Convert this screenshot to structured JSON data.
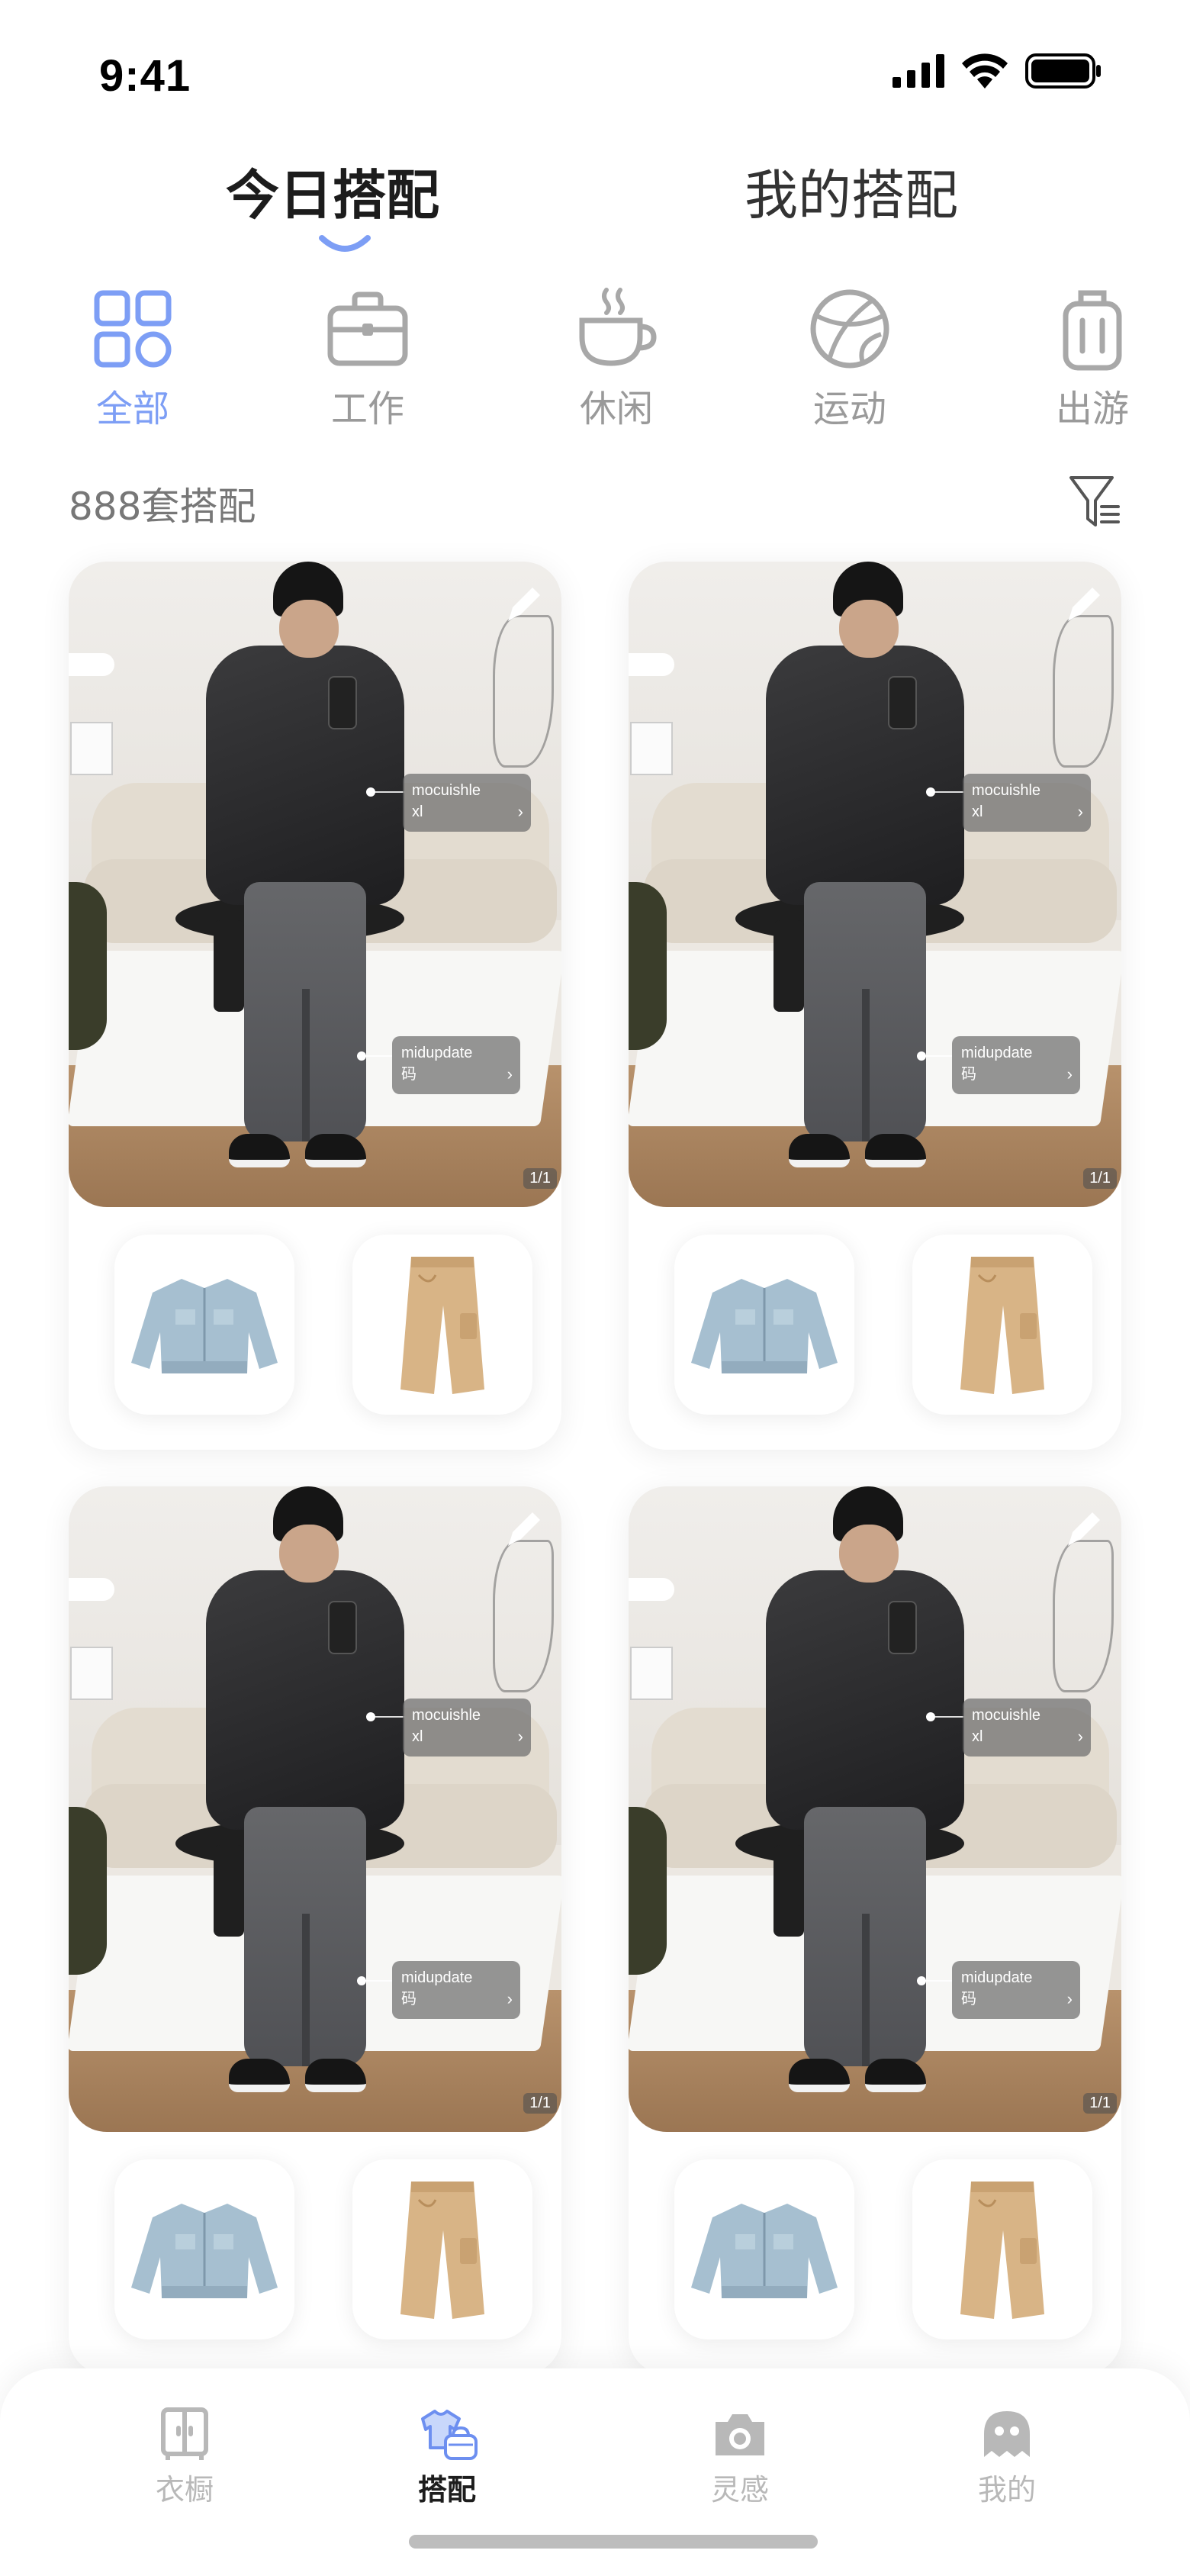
{
  "status_bar": {
    "time": "9:41",
    "icons": [
      "signal-icon",
      "wifi-icon",
      "battery-icon"
    ]
  },
  "top_tabs": [
    {
      "label": "今日搭配",
      "active": true
    },
    {
      "label": "我的搭配",
      "active": false
    }
  ],
  "categories": [
    {
      "label": "全部",
      "icon": "grid-icon",
      "active": true
    },
    {
      "label": "工作",
      "icon": "briefcase-icon",
      "active": false
    },
    {
      "label": "休闲",
      "icon": "coffee-cup-icon",
      "active": false
    },
    {
      "label": "运动",
      "icon": "basketball-icon",
      "active": false
    },
    {
      "label": "出游",
      "icon": "luggage-icon",
      "active": false
    }
  ],
  "outfit_count": "888套搭配",
  "filter_icon": "filter-icon",
  "outfits": [
    {
      "tags": [
        {
          "brand": "mocuishle",
          "size": "xl"
        },
        {
          "brand": "midupdate",
          "size": "码"
        }
      ],
      "page": "1/1",
      "items": [
        "denim-jacket",
        "khaki-pants"
      ]
    },
    {
      "tags": [
        {
          "brand": "mocuishle",
          "size": "xl"
        },
        {
          "brand": "midupdate",
          "size": "码"
        }
      ],
      "page": "1/1",
      "items": [
        "denim-jacket",
        "khaki-pants"
      ]
    },
    {
      "tags": [
        {
          "brand": "mocuishle",
          "size": "xl"
        },
        {
          "brand": "midupdate",
          "size": "码"
        }
      ],
      "page": "1/1",
      "items": [
        "denim-jacket",
        "khaki-pants"
      ]
    },
    {
      "tags": [
        {
          "brand": "mocuishle",
          "size": "xl"
        },
        {
          "brand": "midupdate",
          "size": "码"
        }
      ],
      "page": "1/1",
      "items": [
        "denim-jacket",
        "khaki-pants"
      ]
    }
  ],
  "bottom_nav": [
    {
      "label": "衣橱",
      "icon": "wardrobe-icon",
      "active": false
    },
    {
      "label": "搭配",
      "icon": "outfit-icon",
      "active": true
    },
    {
      "label": "灵感",
      "icon": "camera-icon",
      "active": false
    },
    {
      "label": "我的",
      "icon": "ghost-avatar-icon",
      "active": false
    }
  ],
  "colors": {
    "accent": "#7d9ef5",
    "inactive": "#9a9a9a",
    "text": "#222222"
  }
}
